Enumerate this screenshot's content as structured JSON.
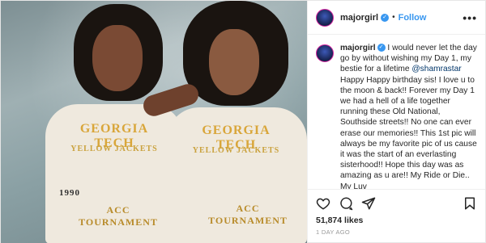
{
  "post": {
    "username": "majorgirl",
    "follow_label": "Follow",
    "separator": "•",
    "more_label": "•••",
    "caption": {
      "username": "majorgirl",
      "text_before_mention": " I would never let the day go by without wishing my Day 1, my bestie for a lifetime ",
      "mention": "@shamrastar",
      "text_after_mention": " Happy Happy birthday sis! I love u to the moon & back!! Forever my Day 1 we had a hell of a life together running these Old National, Southside streets!! No one can ever erase our memories!! This 1st pic will always be my favorite pic of us cause it was the start of an everlasting sisterhood!! Hope this day was as amazing as u are!! My Ride or Die.. My Luv",
      "emoji_line": "♥♥♥♥"
    },
    "likes": "51,874 likes",
    "timestamp": "1 DAY AGO"
  },
  "photo": {
    "left_shirt_top": "GEORGIA TECH",
    "left_shirt_mid": "YELLOW JACKETS",
    "left_shirt_year": "1990",
    "left_shirt_bottom": "ACC TOURNAMENT",
    "right_shirt_top": "GEORGIA TECH",
    "right_shirt_mid": "YELLOW JACKETS",
    "right_shirt_bottom": "ACC TOURNAMENT"
  },
  "icons": [
    "heart-icon",
    "comment-icon",
    "share-icon",
    "bookmark-icon"
  ]
}
